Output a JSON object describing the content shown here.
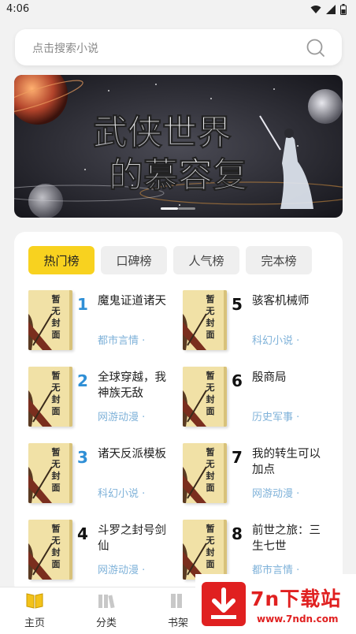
{
  "status_bar": {
    "time": "4:06"
  },
  "search": {
    "placeholder": "点击搜索小说"
  },
  "banner": {
    "title_line1": "武侠世界",
    "title_line2": "的慕容复"
  },
  "ranking": {
    "tabs": [
      {
        "label": "热门榜",
        "active": true
      },
      {
        "label": "口碑榜",
        "active": false
      },
      {
        "label": "人气榜",
        "active": false
      },
      {
        "label": "完本榜",
        "active": false
      }
    ],
    "cover_text": [
      "暂",
      "无",
      "封",
      "面"
    ],
    "books": [
      {
        "rank": "1",
        "title": "魔鬼证道诸天",
        "genre": "都市言情 ·"
      },
      {
        "rank": "2",
        "title": "全球穿越，我神族无敌",
        "genre": "网游动漫 ·"
      },
      {
        "rank": "3",
        "title": "诸天反派模板",
        "genre": "科幻小说 ·"
      },
      {
        "rank": "4",
        "title": "斗罗之封号剑仙",
        "genre": "网游动漫 ·"
      },
      {
        "rank": "5",
        "title": "骇客机械师",
        "genre": "科幻小说 ·"
      },
      {
        "rank": "6",
        "title": "殷商局",
        "genre": "历史军事 ·"
      },
      {
        "rank": "7",
        "title": "我的转生可以加点",
        "genre": "网游动漫 ·"
      },
      {
        "rank": "8",
        "title": "前世之旅：三生七世",
        "genre": "都市言情 ·"
      }
    ]
  },
  "tabbar": [
    {
      "label": "主页",
      "icon": "book-open-icon",
      "active": true
    },
    {
      "label": "分类",
      "icon": "category-books-icon",
      "active": false
    },
    {
      "label": "书架",
      "icon": "bookshelf-icon",
      "active": false
    }
  ],
  "watermark": {
    "logo_text": "7n下载站",
    "url": "www.7ndn.com"
  },
  "colors": {
    "accent": "#f8d21f",
    "rank_top": "#2f8fd6",
    "genre": "#7fb2d9",
    "watermark": "#e02020"
  }
}
